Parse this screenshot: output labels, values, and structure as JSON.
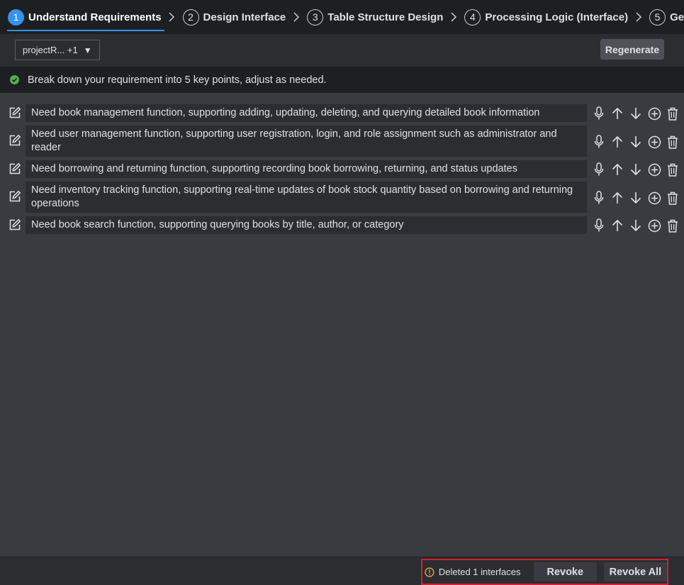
{
  "steps": [
    {
      "num": "1",
      "label": "Understand Requirements"
    },
    {
      "num": "2",
      "label": "Design Interface"
    },
    {
      "num": "3",
      "label": "Table Structure Design"
    },
    {
      "num": "4",
      "label": "Processing Logic (Interface)"
    },
    {
      "num": "5",
      "label": "Genera"
    }
  ],
  "toolbar": {
    "project_select": "projectR... +1",
    "regenerate_label": "Regenerate"
  },
  "banner": {
    "text": "Break down your requirement into 5 key points, adjust as needed."
  },
  "requirements": [
    "Need book management function, supporting adding, updating, deleting, and querying detailed book information",
    "Need user management function, supporting user registration, login, and role assignment such as administrator and reader",
    "Need borrowing and returning function, supporting recording book borrowing, returning, and status updates",
    "Need inventory tracking function, supporting real-time updates of book stock quantity based on borrowing and returning operations",
    "Need book search function, supporting querying books by title, author, or category"
  ],
  "row_actions": [
    "microphone-icon",
    "arrow-up-icon",
    "arrow-down-icon",
    "add-circle-icon",
    "trash-icon"
  ],
  "footer": {
    "message": "Deleted 1 interfaces",
    "revoke_label": "Revoke",
    "revoke_all_label": "Revoke All"
  },
  "colors": {
    "accent": "#3592f0",
    "success": "#4caf50",
    "warning": "#e8a33a",
    "highlight_border": "#d4202f"
  }
}
